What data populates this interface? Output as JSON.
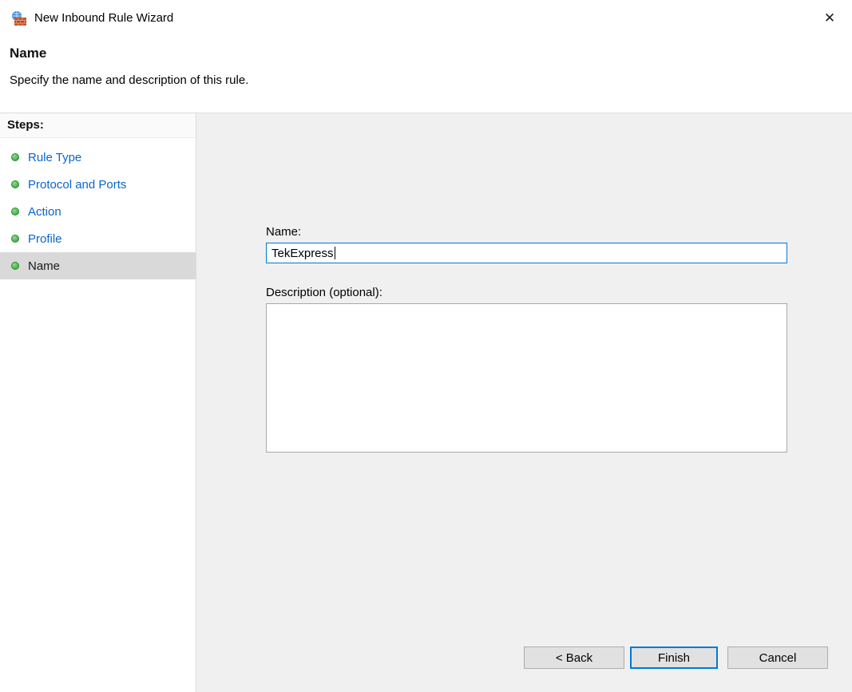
{
  "window": {
    "title": "New Inbound Rule Wizard"
  },
  "icons": {
    "app": "firewall-brick-globe-icon",
    "close_glyph": "✕"
  },
  "header": {
    "title": "Name",
    "subtitle": "Specify the name and description of this rule."
  },
  "sidebar": {
    "heading": "Steps:",
    "steps": [
      {
        "label": "Rule Type",
        "state": "completed"
      },
      {
        "label": "Protocol and Ports",
        "state": "completed"
      },
      {
        "label": "Action",
        "state": "completed"
      },
      {
        "label": "Profile",
        "state": "completed"
      },
      {
        "label": "Name",
        "state": "current"
      }
    ]
  },
  "form": {
    "name_label": "Name:",
    "name_value": "TekExpress",
    "description_label": "Description (optional):",
    "description_value": ""
  },
  "footer": {
    "back_label": "< Back",
    "finish_label": "Finish",
    "cancel_label": "Cancel"
  },
  "colors": {
    "link_blue": "#0a66cc",
    "bullet_green": "#2f9e2f",
    "focus_border": "#0078d7",
    "content_background": "#f0f0f0",
    "current_step_highlight": "#d9d9d9"
  }
}
